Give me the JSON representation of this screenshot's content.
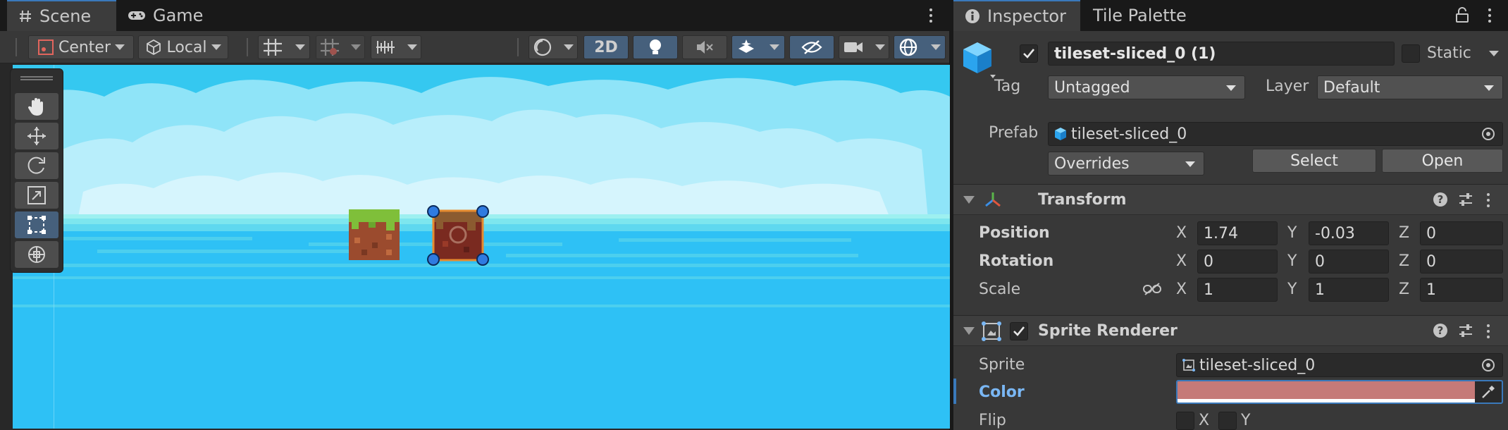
{
  "scene_tabs": [
    {
      "label": "Scene",
      "icon": "hash-icon"
    },
    {
      "label": "Game",
      "icon": "gamepad-icon"
    }
  ],
  "toolbar": {
    "pivot_mode": "Center",
    "pivot_rotation": "Local",
    "two_d_label": "2D"
  },
  "inspector_tabs": [
    {
      "label": "Inspector",
      "icon": "info-icon"
    },
    {
      "label": "Tile Palette"
    }
  ],
  "object": {
    "name": "tileset-sliced_0 (1)",
    "active": true,
    "static_label": "Static",
    "tag_label": "Tag",
    "tag_value": "Untagged",
    "layer_label": "Layer",
    "layer_value": "Default",
    "prefab_label": "Prefab",
    "prefab_value": "tileset-sliced_0",
    "overrides_label": "Overrides",
    "select_label": "Select",
    "open_label": "Open"
  },
  "transform": {
    "title": "Transform",
    "position_label": "Position",
    "rotation_label": "Rotation",
    "scale_label": "Scale",
    "axis_x": "X",
    "axis_y": "Y",
    "axis_z": "Z",
    "position": {
      "x": "1.74",
      "y": "-0.03",
      "z": "0"
    },
    "rotation": {
      "x": "0",
      "y": "0",
      "z": "0"
    },
    "scale": {
      "x": "1",
      "y": "1",
      "z": "1"
    }
  },
  "sprite_renderer": {
    "title": "Sprite Renderer",
    "enabled": true,
    "sprite_label": "Sprite",
    "sprite_value": "tileset-sliced_0",
    "color_label": "Color",
    "color_value": "#c57a78",
    "flip_label": "Flip",
    "flip_x": "X",
    "flip_y": "Y"
  },
  "colors": {
    "accent_blue": "#3a79bb",
    "sky_top": "#35c8f0",
    "sea": "#2ec1f5"
  }
}
